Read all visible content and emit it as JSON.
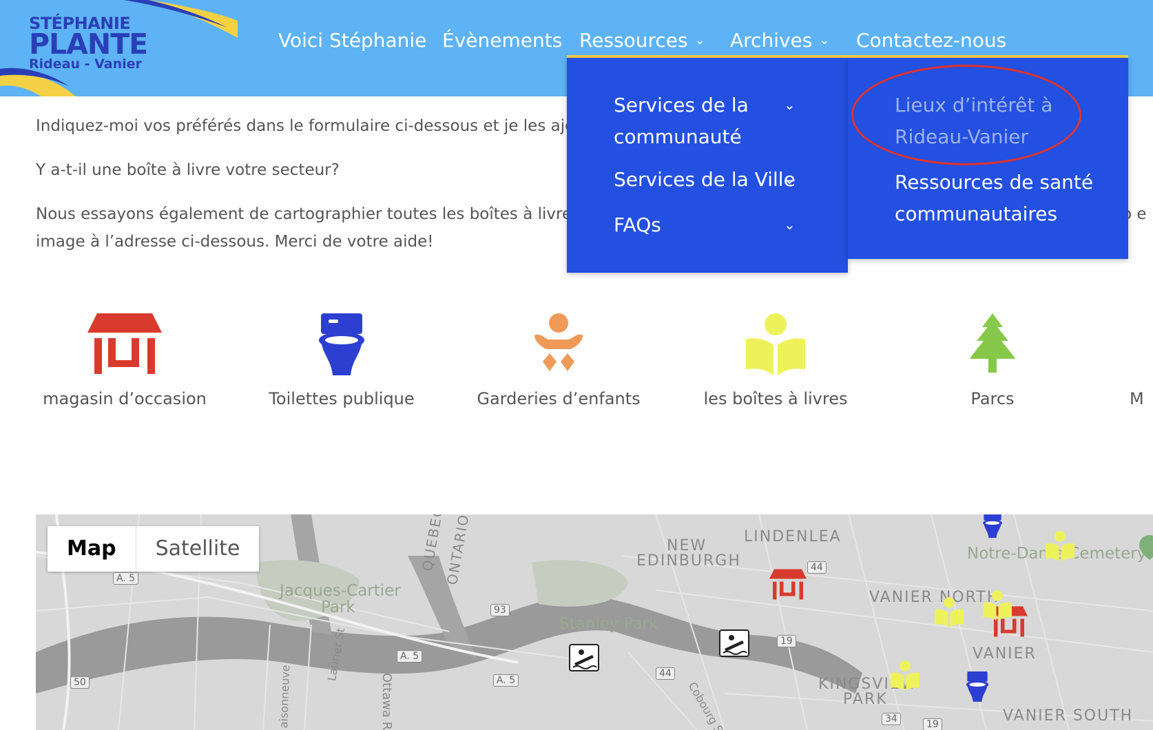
{
  "logo": {
    "line1": "STÉPHANIE",
    "line2": "PLANTE",
    "line3": "Rideau - Vanier"
  },
  "nav": {
    "items": [
      {
        "label": "Voici Stéphanie",
        "has_chevron": false
      },
      {
        "label": "Évènements",
        "has_chevron": false
      },
      {
        "label": "Ressources",
        "has_chevron": true
      },
      {
        "label": "Archives",
        "has_chevron": true
      },
      {
        "label": "Contactez-nous",
        "has_chevron": false
      }
    ]
  },
  "content": {
    "para1": "Indiquez-moi vos préférés dans le formulaire ci-dessous et je les ajo",
    "para2": "Y a-t-il une boîte à livre votre secteur?",
    "para3_line1": "Nous essayons également de cartographier toutes les boîtes à livres",
    "para3_line1_tail": "to e",
    "para3_line2": "image à l’adresse ci-dessous. Merci de votre aide!"
  },
  "dropdown": {
    "items": [
      {
        "label_line1": "Services de la",
        "label_line2": "communauté"
      },
      {
        "label_line1": "Services de la Ville",
        "label_line2": ""
      },
      {
        "label_line1": "FAQs",
        "label_line2": ""
      }
    ],
    "submenu": [
      {
        "label_line1": "Lieux d’intérêt à",
        "label_line2": "Rideau-Vanier",
        "highlighted": true
      },
      {
        "label_line1": "Ressources de santé",
        "label_line2": "communautaires",
        "highlighted": false
      }
    ]
  },
  "categories": [
    {
      "label": "magasin d’occasion",
      "icon": "store-icon",
      "color": "#d93a2e"
    },
    {
      "label": "Toilettes publique",
      "icon": "toilet-icon",
      "color": "#2c3fd1"
    },
    {
      "label": "Garderies d’enfants",
      "icon": "baby-icon",
      "color": "#ef9a58"
    },
    {
      "label": "les boîtes à livres",
      "icon": "book-reader-icon",
      "color": "#eef25a"
    },
    {
      "label": "Parcs",
      "icon": "tree-icon",
      "color": "#86c94a"
    },
    {
      "label": "M",
      "icon": "",
      "color": ""
    }
  ],
  "map": {
    "toggle": {
      "map": "Map",
      "satellite": "Satellite"
    },
    "labels": {
      "new_edinburgh_1": "NEW",
      "new_edinburgh_2": "EDINBURGH",
      "lindenlea": "LINDENLEA",
      "notre_dame": "Notre-Dame Cemetery",
      "vanier_north": "VANIER NORTH",
      "vanier": "VANIER",
      "vanier_south": "VANIER SOUTH",
      "kingsview_1": "KINGSVIEW",
      "kingsview_2": "PARK",
      "jacques_1": "Jacques-Cartier",
      "jacques_2": "Park",
      "stanley": "Stanley Park",
      "quebec": "QUEBEC",
      "ontario": "ONTARIO",
      "ottawa_river": "Ottawa R",
      "laurier": "Laurier St",
      "maisonneuve": "aisonneuve",
      "coburg": "Cobourg St"
    },
    "routes": [
      "A. 5",
      "93",
      "A. 5",
      "A. 5",
      "50",
      "44",
      "19",
      "44",
      "34",
      "19"
    ]
  },
  "colors": {
    "header_bg": "#5db3f5",
    "logo_text": "#2a3fb7",
    "menu_bg": "#2350e0",
    "accent_yellow": "#f4d144",
    "highlight_oval": "#e0322b"
  }
}
